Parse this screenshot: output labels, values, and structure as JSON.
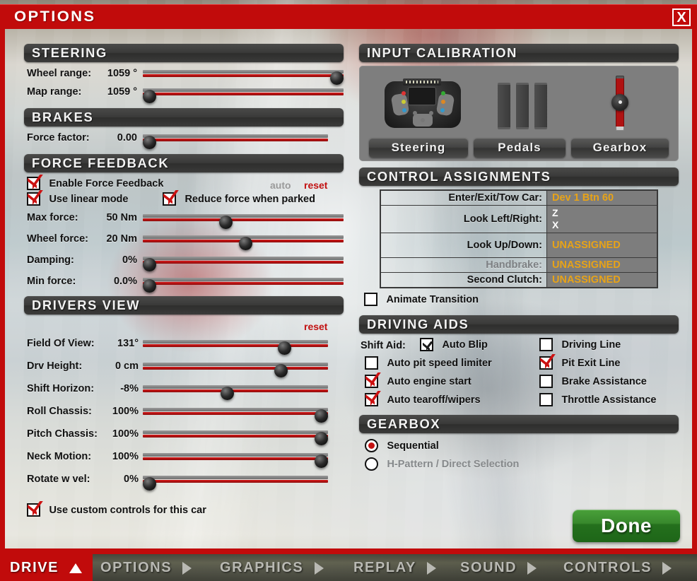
{
  "window": {
    "title": "OPTIONS",
    "close_label": "X"
  },
  "steering": {
    "header": "STEERING",
    "sliders": [
      {
        "label": "Wheel range:",
        "value": "1059 °",
        "pos": 100
      },
      {
        "label": "Map range:",
        "value": "1059 °",
        "pos": 0
      }
    ]
  },
  "brakes": {
    "header": "BRAKES",
    "sliders": [
      {
        "label": "Force factor:",
        "value": "0.00",
        "pos": 0
      }
    ]
  },
  "force_feedback": {
    "header": "FORCE FEEDBACK",
    "auto_label": "auto",
    "reset_label": "reset",
    "checkboxes": [
      {
        "label": "Enable Force Feedback",
        "checked": true
      },
      {
        "label": "Use linear mode",
        "checked": true
      },
      {
        "label": "Reduce force when parked",
        "checked": true
      }
    ],
    "sliders": [
      {
        "label": "Max force:",
        "value": "50 Nm",
        "pos": 38
      },
      {
        "label": "Wheel force:",
        "value": "20 Nm",
        "pos": 48
      },
      {
        "label": "Damping:",
        "value": "0%",
        "pos": 0
      },
      {
        "label": "Min force:",
        "value": "0.0%",
        "pos": 0
      }
    ]
  },
  "drivers_view": {
    "header": "DRIVERS VIEW",
    "reset_label": "reset",
    "sliders": [
      {
        "label": "Field Of View:",
        "value": "131°",
        "pos": 73
      },
      {
        "label": "Drv Height:",
        "value": "0 cm",
        "pos": 71
      },
      {
        "label": "Shift Horizon:",
        "value": "-8%",
        "pos": 42
      },
      {
        "label": "Roll Chassis:",
        "value": "100%",
        "pos": 100
      },
      {
        "label": "Pitch Chassis:",
        "value": "100%",
        "pos": 100
      },
      {
        "label": "Neck Motion:",
        "value": "100%",
        "pos": 100
      },
      {
        "label": "Rotate w vel:",
        "value": "0%",
        "pos": 0
      }
    ]
  },
  "custom_controls": {
    "label": "Use custom controls for this car",
    "checked": true
  },
  "input_calibration": {
    "header": "INPUT CALIBRATION",
    "buttons": [
      {
        "label": "Steering",
        "icon": "steering-wheel-icon"
      },
      {
        "label": "Pedals",
        "icon": "pedals-icon"
      },
      {
        "label": "Gearbox",
        "icon": "gearbox-shifter-icon"
      }
    ]
  },
  "control_assignments": {
    "header": "CONTROL ASSIGNMENTS",
    "rows": [
      {
        "name": "Enter/Exit/Tow Car:",
        "value": "Dev 1 Btn 60",
        "style": "amber",
        "dim": false
      },
      {
        "name": "Look Left/Right:",
        "value": "Z\nX",
        "style": "keys",
        "dim": false
      },
      {
        "name": "Look Up/Down:",
        "value": "UNASSIGNED",
        "style": "amber",
        "dim": false
      },
      {
        "name": "Handbrake:",
        "value": "UNASSIGNED",
        "style": "amber",
        "dim": true
      },
      {
        "name": "Second Clutch:",
        "value": "UNASSIGNED",
        "style": "amber",
        "dim": false
      }
    ],
    "animate_transition": {
      "label": "Animate Transition",
      "checked": false
    }
  },
  "driving_aids": {
    "header": "DRIVING AIDS",
    "shift_aid_label": "Shift Aid:",
    "left_column": [
      {
        "label": "Auto Blip",
        "checked": true,
        "dark": true
      },
      {
        "label": "Auto pit speed limiter",
        "checked": false,
        "dark": false
      },
      {
        "label": "Auto engine start",
        "checked": true,
        "dark": false
      },
      {
        "label": "Auto tearoff/wipers",
        "checked": true,
        "dark": false
      }
    ],
    "right_column": [
      {
        "label": "Driving Line",
        "checked": false
      },
      {
        "label": "Pit Exit Line",
        "checked": true
      },
      {
        "label": "Brake Assistance",
        "checked": false
      },
      {
        "label": "Throttle Assistance",
        "checked": false
      }
    ]
  },
  "gearbox": {
    "header": "GEARBOX",
    "options": [
      {
        "label": "Sequential",
        "selected": true,
        "dim": false
      },
      {
        "label": "H-Pattern / Direct Selection",
        "selected": false,
        "dim": true
      }
    ]
  },
  "done_button": {
    "label": "Done"
  },
  "nav": {
    "items": [
      {
        "label": "DRIVE",
        "active": true,
        "arrow": "up"
      },
      {
        "label": "OPTIONS",
        "active": false,
        "arrow": "right"
      },
      {
        "label": "GRAPHICS",
        "active": false,
        "arrow": "right"
      },
      {
        "label": "REPLAY",
        "active": false,
        "arrow": "right"
      },
      {
        "label": "SOUND",
        "active": false,
        "arrow": "right"
      },
      {
        "label": "CONTROLS",
        "active": false,
        "arrow": "right"
      }
    ]
  },
  "colors": {
    "accent_red": "#c10b0b",
    "amber": "#e8a317",
    "green": "#2d7a22",
    "header_dark": "#3a3a39"
  }
}
